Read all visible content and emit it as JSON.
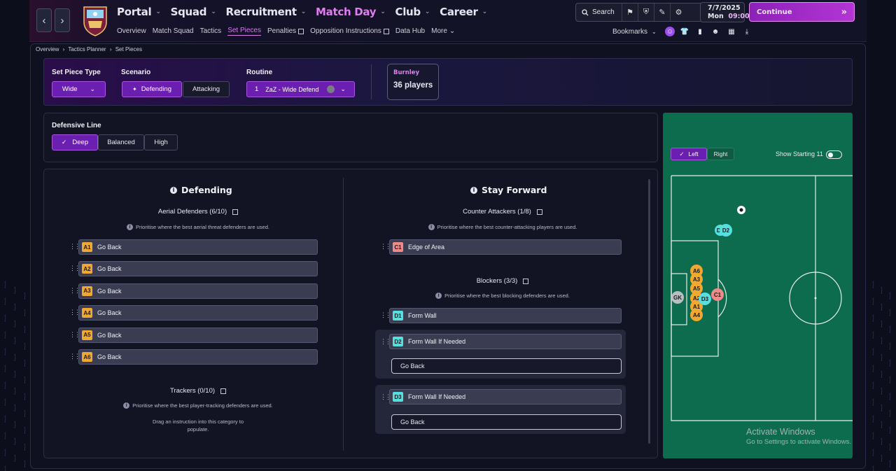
{
  "header": {
    "nav_back": "‹",
    "nav_forward": "›",
    "main_nav": [
      {
        "label": "Portal",
        "active": false
      },
      {
        "label": "Squad",
        "active": false
      },
      {
        "label": "Recruitment",
        "active": false
      },
      {
        "label": "Match Day",
        "active": true
      },
      {
        "label": "Club",
        "active": false
      },
      {
        "label": "Career",
        "active": false
      }
    ],
    "sub_nav": [
      {
        "label": "Overview",
        "active": false,
        "external": false
      },
      {
        "label": "Match Squad",
        "active": false,
        "external": false
      },
      {
        "label": "Tactics",
        "active": false,
        "external": false
      },
      {
        "label": "Set Pieces",
        "active": true,
        "external": false
      },
      {
        "label": "Penalties",
        "active": false,
        "external": true
      },
      {
        "label": "Opposition Instructions",
        "active": false,
        "external": true
      },
      {
        "label": "Data Hub",
        "active": false,
        "external": false
      },
      {
        "label": "More",
        "active": false,
        "external": false
      }
    ],
    "search_label": "Search",
    "date": "7/7/2025",
    "day": "Mon",
    "time": "09:00",
    "continue_label": "Continue",
    "bookmarks_label": "Bookmarks"
  },
  "breadcrumb": {
    "items": [
      "Overview",
      "Tactics Planner",
      "Set Pieces"
    ]
  },
  "setpiece": {
    "type_label": "Set Piece Type",
    "type_value": "Wide",
    "scenario_label": "Scenario",
    "scenario_defending": "Defending",
    "scenario_attacking": "Attacking",
    "routine_label": "Routine",
    "routine_number": "1",
    "routine_value": "ZaZ - Wide Defend",
    "club_name": "Burnley",
    "club_players": "36 players"
  },
  "defensive_line": {
    "label": "Defensive Line",
    "options": [
      "Deep",
      "Balanced",
      "High"
    ],
    "selected": "Deep"
  },
  "defending": {
    "title": "Defending",
    "aerial_title": "Aerial Defenders (6/10)",
    "aerial_hint": "Prioritise where the best aerial threat defenders are used.",
    "aerial_rows": [
      {
        "tag": "A1",
        "label": "Go Back"
      },
      {
        "tag": "A2",
        "label": "Go Back"
      },
      {
        "tag": "A3",
        "label": "Go Back"
      },
      {
        "tag": "A4",
        "label": "Go Back"
      },
      {
        "tag": "A5",
        "label": "Go Back"
      },
      {
        "tag": "A6",
        "label": "Go Back"
      }
    ],
    "trackers_title": "Trackers (0/10)",
    "trackers_hint": "Prioritise where the best player-tracking defenders are used.",
    "trackers_empty_1": "Drag an instruction into this category to",
    "trackers_empty_2": "populate."
  },
  "stay_forward": {
    "title": "Stay Forward",
    "counter_title": "Counter Attackers (1/8)",
    "counter_hint": "Prioritise where the best counter-attacking players are used.",
    "counter_rows": [
      {
        "tag": "C1",
        "label": "Edge of Area"
      }
    ],
    "blockers_title": "Blockers (3/3)",
    "blockers_hint": "Prioritise where the best blocking defenders are used.",
    "blockers_rows": [
      {
        "tag": "D1",
        "label": "Form Wall",
        "sub": ""
      },
      {
        "tag": "D2",
        "label": "Form Wall If Needed",
        "sub": "Go Back"
      },
      {
        "tag": "D3",
        "label": "Form Wall If Needed",
        "sub": "Go Back"
      }
    ]
  },
  "pitch": {
    "side_left": "Left",
    "side_right": "Right",
    "side_selected": "Left",
    "show_starting_label": "Show Starting 11",
    "markers": {
      "gk": "GK",
      "d1": "D1",
      "d2": "D2",
      "d3": "D3",
      "c1": "C1",
      "a6": "A6",
      "a3": "A3",
      "a5": "A5",
      "a2": "A2",
      "a1": "A1",
      "a4": "A4"
    }
  },
  "watermark": {
    "line1": "Activate Windows",
    "line2": "Go to Settings to activate Windows."
  },
  "colors": {
    "accent": "#6b1fb0",
    "active_nav": "#e17cf0",
    "pitch": "#0d6b4e",
    "aerial_tag": "#f0a830",
    "counter_tag": "#f08a8a",
    "blocker_tag": "#55dfe0"
  }
}
